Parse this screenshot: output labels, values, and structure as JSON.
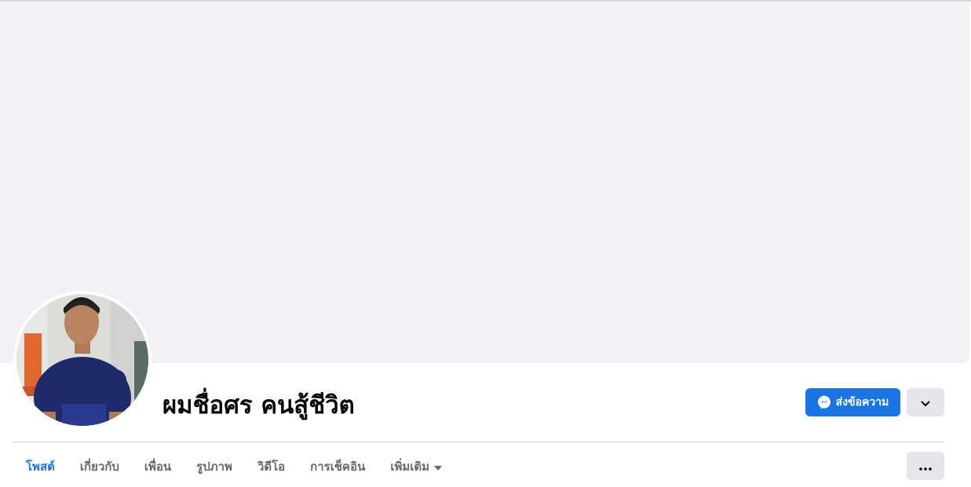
{
  "profile": {
    "name": "ผมชื่อศร คนสู้ชีวิต"
  },
  "actions": {
    "message_label": "ส่งข้อความ",
    "message_icon": "messenger-icon",
    "dropdown_icon": "chevron-down-icon",
    "more_icon": "more-dots-icon"
  },
  "tabs": [
    {
      "label": "โพสต์",
      "active": true
    },
    {
      "label": "เกี่ยวกับ",
      "active": false
    },
    {
      "label": "เพื่อน",
      "active": false
    },
    {
      "label": "รูปภาพ",
      "active": false
    },
    {
      "label": "วิดีโอ",
      "active": false
    },
    {
      "label": "การเช็คอิน",
      "active": false
    },
    {
      "label": "เพิ่มเติม",
      "active": false
    }
  ],
  "colors": {
    "accent": "#1b74e4",
    "cover_bg": "#f0f2f5",
    "secondary_button": "#e4e6eb",
    "tab_text": "#65676b"
  }
}
